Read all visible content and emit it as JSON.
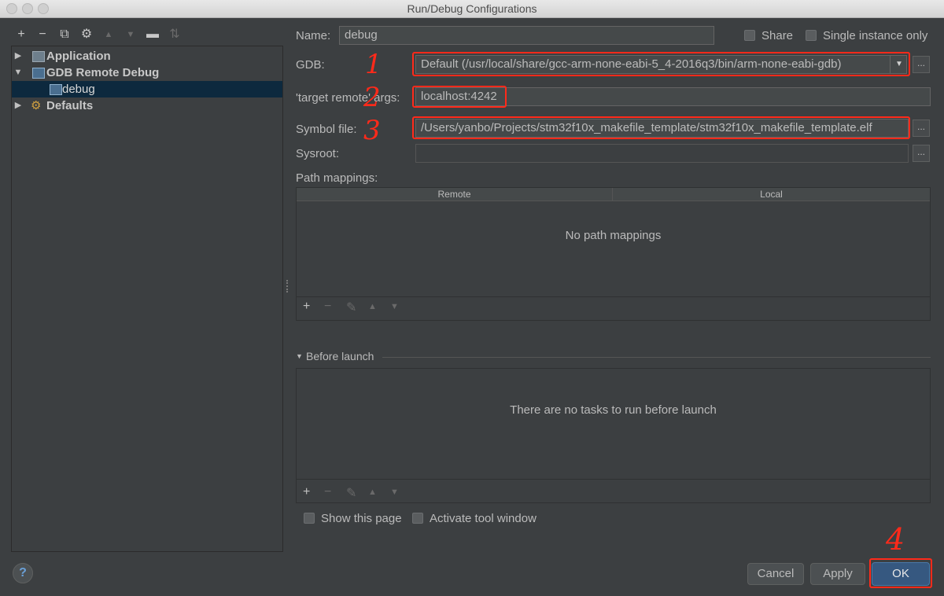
{
  "window": {
    "title": "Run/Debug Configurations"
  },
  "toolbar": {
    "add": "+",
    "remove": "−",
    "copy": "⧉",
    "settings": "⚙",
    "up": "▲",
    "down": "▼",
    "folder": "▬",
    "sort": "⇅"
  },
  "tree": {
    "items": [
      {
        "label": "Application"
      },
      {
        "label": "GDB Remote Debug"
      },
      {
        "label": "debug"
      },
      {
        "label": "Defaults"
      }
    ]
  },
  "form": {
    "name_label": "Name:",
    "name_value": "debug",
    "share_label": "Share",
    "single_instance_label": "Single instance only",
    "gdb_label": "GDB:",
    "gdb_value": "Default (/usr/local/share/gcc-arm-none-eabi-5_4-2016q3/bin/arm-none-eabi-gdb)",
    "target_label": "'target remote' args:",
    "target_value": "localhost:4242",
    "symbol_label": "Symbol file:",
    "symbol_value": "/Users/yanbo/Projects/stm32f10x_makefile_template/stm32f10x_makefile_template.elf",
    "sysroot_label": "Sysroot:",
    "sysroot_value": "",
    "ellipsis": "...",
    "path_mappings_label": "Path mappings:",
    "col_remote": "Remote",
    "col_local": "Local",
    "no_mappings": "No path mappings",
    "before_launch_label": "Before launch",
    "no_tasks": "There are no tasks to run before launch",
    "show_page_label": "Show this page",
    "activate_tool_label": "Activate tool window"
  },
  "annotations": {
    "one": "1",
    "two": "2",
    "three": "3",
    "four": "4"
  },
  "buttons": {
    "help": "?",
    "cancel": "Cancel",
    "apply": "Apply",
    "ok": "OK"
  },
  "colors": {
    "annotation": "#ff2a1a",
    "background": "#3c3f41",
    "selection": "#0d293e"
  }
}
